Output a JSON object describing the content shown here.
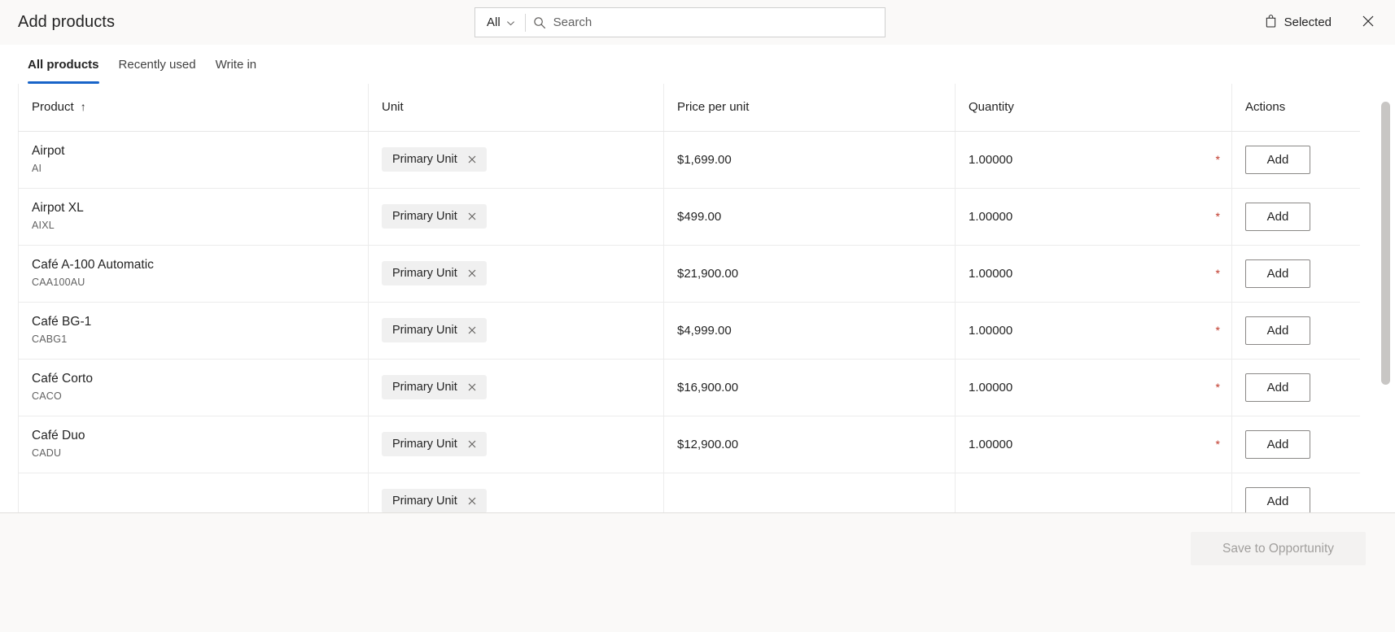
{
  "header": {
    "title": "Add products",
    "search": {
      "scope_label": "All",
      "placeholder": "Search",
      "value": "",
      "scope_icon": "chevron-down-icon",
      "icon": "search-icon"
    },
    "selected_label": "Selected",
    "selected_icon": "shopping-bag-icon",
    "close_icon": "close-icon"
  },
  "tabs": [
    {
      "label": "All products",
      "active": true
    },
    {
      "label": "Recently used",
      "active": false
    },
    {
      "label": "Write in",
      "active": false
    }
  ],
  "table": {
    "columns": [
      {
        "label": "Product",
        "sort": "↑"
      },
      {
        "label": "Unit",
        "sort": ""
      },
      {
        "label": "Price per unit",
        "sort": ""
      },
      {
        "label": "Quantity",
        "sort": ""
      },
      {
        "label": "Actions",
        "sort": ""
      }
    ],
    "action_label": "Add",
    "required_marker": "*",
    "rows": [
      {
        "name": "Airpot",
        "code": "AI",
        "unit": "Primary Unit",
        "price": "$1,699.00",
        "quantity": "1.00000"
      },
      {
        "name": "Airpot XL",
        "code": "AIXL",
        "unit": "Primary Unit",
        "price": "$499.00",
        "quantity": "1.00000"
      },
      {
        "name": "Café A-100 Automatic",
        "code": "CAA100AU",
        "unit": "Primary Unit",
        "price": "$21,900.00",
        "quantity": "1.00000"
      },
      {
        "name": "Café BG-1",
        "code": "CABG1",
        "unit": "Primary Unit",
        "price": "$4,999.00",
        "quantity": "1.00000"
      },
      {
        "name": "Café Corto",
        "code": "CACO",
        "unit": "Primary Unit",
        "price": "$16,900.00",
        "quantity": "1.00000"
      },
      {
        "name": "Café Duo",
        "code": "CADU",
        "unit": "Primary Unit",
        "price": "$12,900.00",
        "quantity": "1.00000"
      },
      {
        "name": "",
        "code": "",
        "unit": "Primary Unit",
        "price": "",
        "quantity": ""
      }
    ]
  },
  "footer": {
    "save_label": "Save to Opportunity",
    "save_disabled": true
  },
  "colors": {
    "accent": "#1864c8",
    "header_bg": "#faf9f8",
    "required": "#c0392b",
    "tag_bg": "#f0f0f0"
  }
}
